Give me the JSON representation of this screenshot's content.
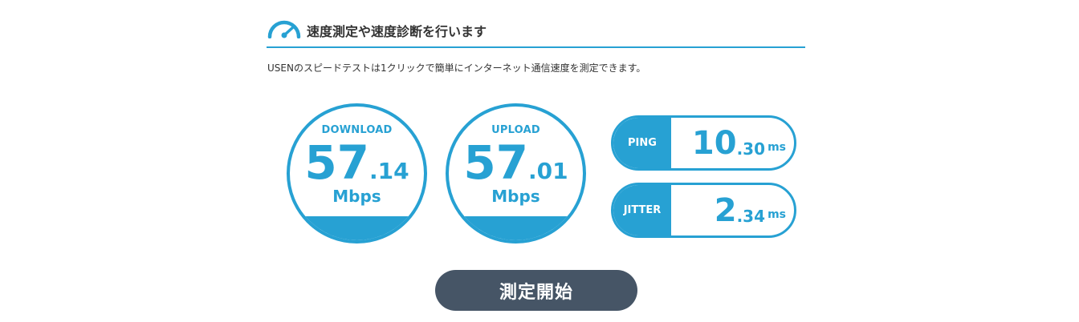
{
  "header": {
    "icon": "speedometer-icon",
    "title": "速度測定や速度診断を行います"
  },
  "description": "USENのスピードテストは1クリックで簡単にインターネット通信速度を測定できます。",
  "colors": {
    "accent": "#27a1d3",
    "button": "#465566",
    "text": "#333333"
  },
  "download": {
    "label": "DOWNLOAD",
    "value_int": "57",
    "value_dec": ".14",
    "unit": "Mbps",
    "fill_fraction": 0.18
  },
  "upload": {
    "label": "UPLOAD",
    "value_int": "57",
    "value_dec": ".01",
    "unit": "Mbps",
    "fill_fraction": 0.18
  },
  "ping": {
    "label": "PING",
    "value_int": "10",
    "value_dec": ".30",
    "unit": "ms"
  },
  "jitter": {
    "label": "JITTER",
    "value_int": "2",
    "value_dec": ".34",
    "unit": "ms"
  },
  "start_button": {
    "label": "測定開始"
  }
}
